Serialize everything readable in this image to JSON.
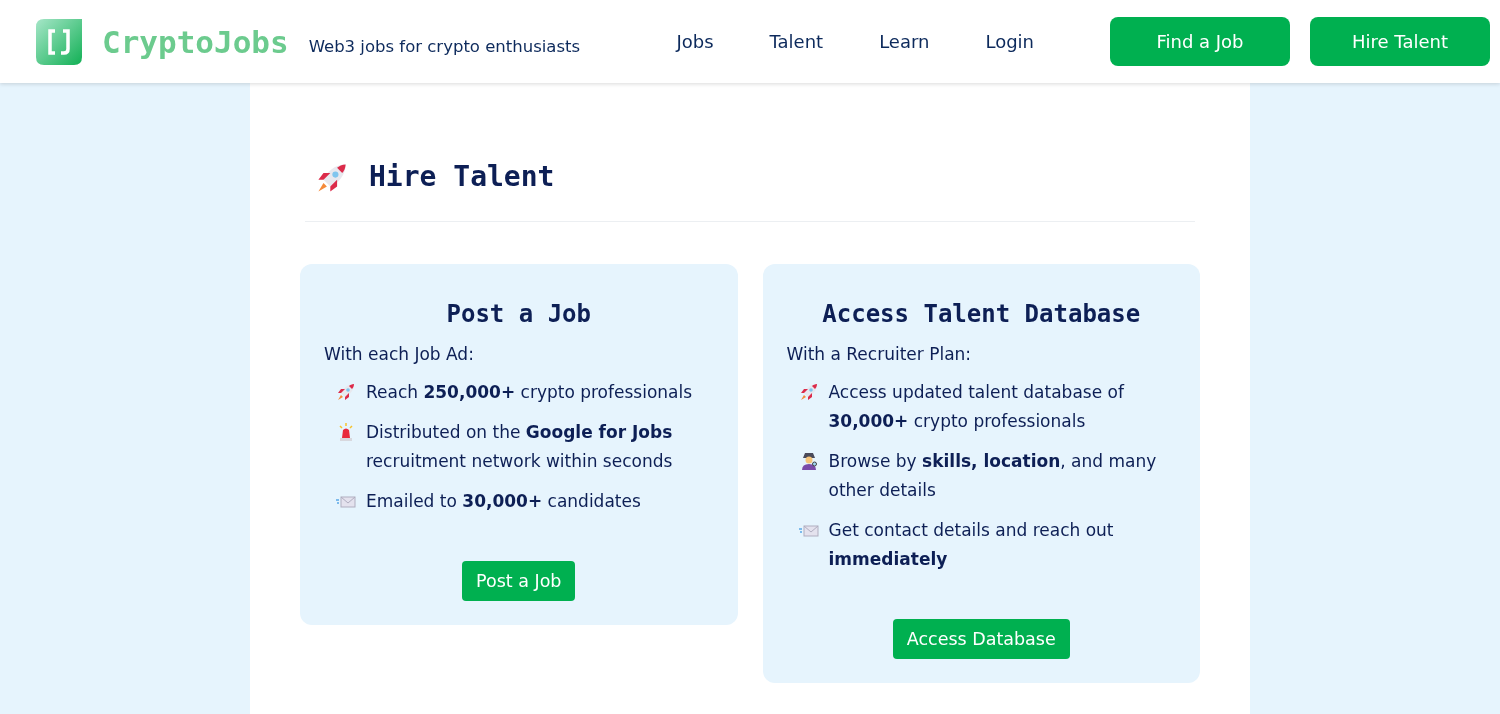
{
  "header": {
    "brand": "CryptoJobs",
    "tagline": "Web3 jobs for crypto enthusiasts",
    "nav": [
      "Jobs",
      "Talent",
      "Learn",
      "Login"
    ],
    "buttons": [
      "Find a Job",
      "Hire Talent"
    ]
  },
  "page": {
    "title": "Hire Talent",
    "title_icon": {
      "kind": "rocket"
    },
    "cards": [
      {
        "title": "Post a Job",
        "intro": "With each Job Ad:",
        "items": [
          {
            "kind": "rocket",
            "text": "Reach **250,000+** crypto professionals"
          },
          {
            "kind": "siren",
            "text": "Distributed on the **Google for Jobs** recruitment network within seconds"
          },
          {
            "kind": "envelope",
            "text": "Emailed to **30,000+** candidates"
          }
        ],
        "button": "Post a Job"
      },
      {
        "title": "Access Talent Database",
        "intro": "With a Recruiter Plan:",
        "items": [
          {
            "kind": "rocket",
            "text": "Access updated talent database of **30,000+** crypto professionals"
          },
          {
            "kind": "detective",
            "text": "Browse by **skills, location**, and many other details"
          },
          {
            "kind": "envelope",
            "text": "Get contact details and reach out **immediately**"
          }
        ],
        "button": "Access Database"
      }
    ]
  }
}
